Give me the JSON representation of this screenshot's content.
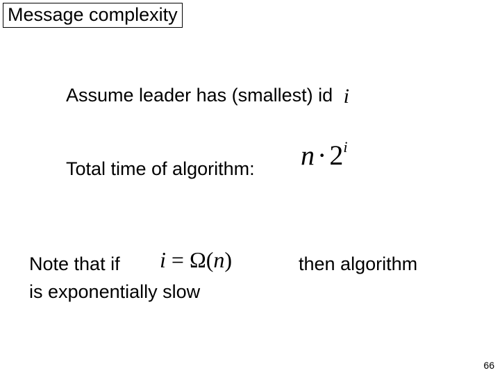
{
  "title": "Message complexity",
  "line1_text": "Assume leader has (smallest) id",
  "line1_var": "i",
  "line2_text": "Total time of algorithm:",
  "formula_time": {
    "n": "n",
    "dot": "·",
    "base": "2",
    "exp": "i"
  },
  "line3_part1": "Note that if",
  "formula_cond": {
    "lhs": "i",
    "eq": " = ",
    "omega": "Ω",
    "open": "(",
    "arg": "n",
    "close": ")"
  },
  "line3_then": "then algorithm",
  "line3_part2": "is exponentially slow",
  "page_number": "66"
}
